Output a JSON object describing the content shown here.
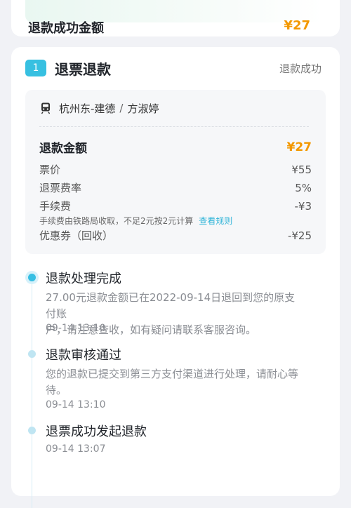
{
  "summary": {
    "label": "退款成功金额",
    "amount": "¥27"
  },
  "section": {
    "step_number": "1",
    "title": "退票退款",
    "status": "退款成功"
  },
  "ticket": {
    "route": "杭州东-建德",
    "separator": "/",
    "passenger": "方淑婷",
    "icon": "train-icon"
  },
  "details": {
    "refund_amount_label": "退款金额",
    "refund_amount_value": "¥27",
    "ticket_price_label": "票价",
    "ticket_price_value": "¥55",
    "fee_rate_label": "退票费率",
    "fee_rate_value": "5%",
    "fee_label": "手续费",
    "fee_value": "-¥3",
    "fee_note": "手续费由铁路局收取，不足2元按2元计算",
    "fee_rule_link": "查看规则",
    "coupon_label": "优惠券（回收）",
    "coupon_value": "-¥25"
  },
  "timeline": [
    {
      "title": "退款处理完成",
      "desc_line1": "27.00元退款金额已在2022-09-14日退回到您的原支付账",
      "desc_line2": "户，请注意查收，如有疑问请联系客服咨询。",
      "time": "09-14 13:10"
    },
    {
      "title": "退款审核通过",
      "desc_line1": "您的退款已提交到第三方支付渠道进行处理，请耐心等",
      "desc_line2": "待。",
      "time": "09-14 13:10"
    },
    {
      "title": "退票成功发起退款",
      "time": "09-14 13:07"
    }
  ],
  "colors": {
    "accent": "#37c0e1",
    "amount": "#f39800",
    "link": "#2fb4d8"
  }
}
